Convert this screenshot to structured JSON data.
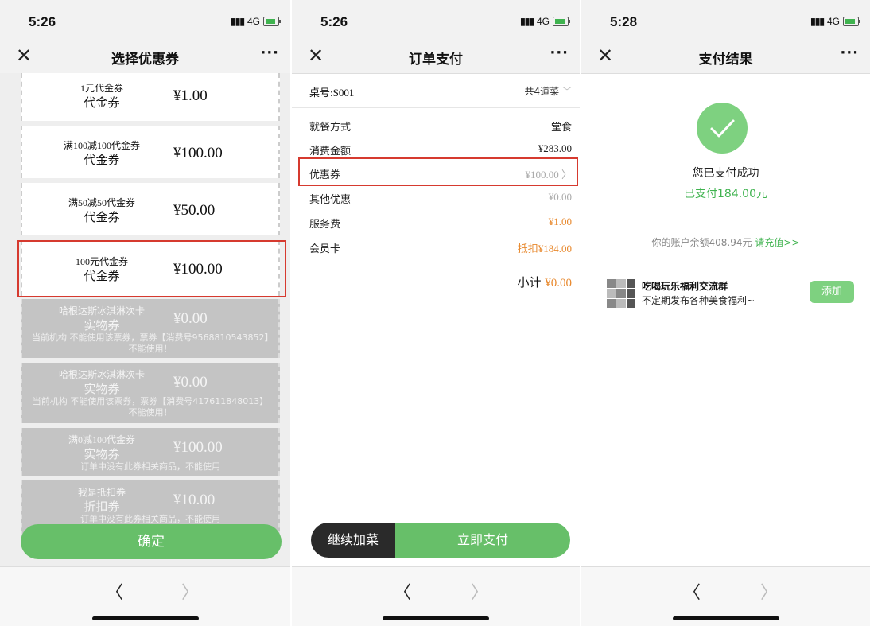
{
  "common": {
    "network": "4G",
    "back": "〈",
    "forward": "〉",
    "close": "✕",
    "more": "···"
  },
  "phone1": {
    "time": "5:26",
    "title": "选择优惠券",
    "coupons": [
      {
        "name": "1元代金券",
        "type": "代金券",
        "value": "¥1.00",
        "note": "",
        "enabled": true
      },
      {
        "name": "满100减100代金券",
        "type": "代金券",
        "value": "¥100.00",
        "note": "",
        "enabled": true
      },
      {
        "name": "满50减50代金券",
        "type": "代金券",
        "value": "¥50.00",
        "note": "",
        "enabled": true
      },
      {
        "name": "100元代金券",
        "type": "代金券",
        "value": "¥100.00",
        "note": "",
        "enabled": true,
        "selected": true
      },
      {
        "name": "哈根达斯冰淇淋次卡",
        "type": "实物券",
        "value": "¥0.00",
        "note": "当前机构 不能使用该票券，票券【消费号9568810543852】不能使用！",
        "enabled": false
      },
      {
        "name": "哈根达斯冰淇淋次卡",
        "type": "实物券",
        "value": "¥0.00",
        "note": "当前机构 不能使用该票券，票券【消费号417611848013】不能使用！",
        "enabled": false
      },
      {
        "name": "满0减100代金券",
        "type": "实物券",
        "value": "¥100.00",
        "note": "订单中没有此券相关商品，不能使用",
        "enabled": false
      },
      {
        "name": "我是抵扣券",
        "type": "折扣券",
        "value": "¥10.00",
        "note": "订单中没有此券相关商品，不能使用",
        "enabled": false
      }
    ],
    "confirm": "确定"
  },
  "phone2": {
    "time": "5:26",
    "title": "订单支付",
    "table_no": "桌号:S001",
    "dish_count": "共4道菜",
    "rows": [
      {
        "label": "就餐方式",
        "value": "堂食"
      },
      {
        "label": "消费金额",
        "value": "¥283.00"
      },
      {
        "label": "优惠券",
        "value": "¥100.00 〉"
      },
      {
        "label": "其他优惠",
        "value": "¥0.00"
      },
      {
        "label": "服务费",
        "value": "¥1.00"
      },
      {
        "label": "会员卡",
        "value": "抵扣¥184.00"
      }
    ],
    "subtotal_label": "小计",
    "subtotal_value": "¥0.00",
    "continue": "继续加菜",
    "pay_now": "立即支付"
  },
  "phone3": {
    "time": "5:28",
    "title": "支付结果",
    "success": "您已支付成功",
    "paid": "已支付184.00元",
    "balance": "你的账户余额408.94元",
    "recharge": "请充值>>",
    "group_name": "吃喝玩乐福利交流群",
    "group_desc": "不定期发布各种美食福利~",
    "add": "添加"
  },
  "colors": {
    "green": "#67bf69",
    "highlight": "#d63a2f",
    "orange": "#e8892e"
  }
}
